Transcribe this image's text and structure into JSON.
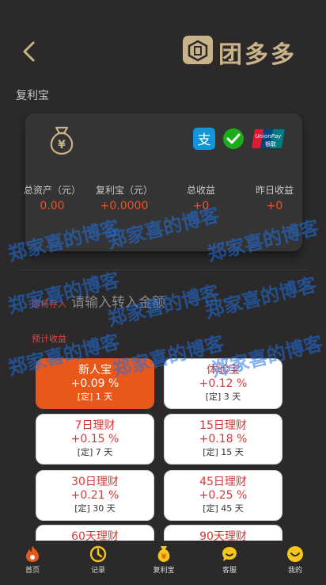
{
  "header": {
    "brand": "团多多"
  },
  "section_title": "复利宝",
  "card": {
    "stats": [
      {
        "label": "总资产（元）",
        "value": "0.00"
      },
      {
        "label": "复利宝（元）",
        "value": "+0.0000"
      },
      {
        "label": "总收益",
        "value": "+0"
      },
      {
        "label": "昨日收益",
        "value": "+0"
      }
    ],
    "unionpay_text": "UnionPay",
    "unionpay_sub": "银联"
  },
  "transfer": {
    "label": "即将存入",
    "placeholder": "请输入转入金额"
  },
  "estimate_label": "预计收益",
  "plans": [
    {
      "name": "新人宝",
      "rate": "+0.09 %",
      "term": "[定] 1 天",
      "active": true
    },
    {
      "name": "体验宝",
      "rate": "+0.12 %",
      "term": "[定] 3 天",
      "active": false
    },
    {
      "name": "7日理财",
      "rate": "+0.15 %",
      "term": "[定] 7 天",
      "active": false
    },
    {
      "name": "15日理财",
      "rate": "+0.18 %",
      "term": "[定] 15 天",
      "active": false
    },
    {
      "name": "30日理财",
      "rate": "+0.21 %",
      "term": "[定] 30 天",
      "active": false
    },
    {
      "name": "45日理财",
      "rate": "+0.25 %",
      "term": "[定] 45 天",
      "active": false
    },
    {
      "name": "60天理财",
      "rate": "",
      "term": "",
      "active": false
    },
    {
      "name": "90天理财",
      "rate": "",
      "term": "",
      "active": false
    }
  ],
  "watermark": "郑家喜的博客",
  "tabs": [
    {
      "label": "首页",
      "icon": "home-flame-icon"
    },
    {
      "label": "记录",
      "icon": "record-icon"
    },
    {
      "label": "复利宝",
      "icon": "money-bag-icon"
    },
    {
      "label": "客服",
      "icon": "chat-icon"
    },
    {
      "label": "我的",
      "icon": "smile-icon"
    }
  ],
  "colors": {
    "accent": "#e8581b",
    "gold": "#c9b48a",
    "background": "#2b2929",
    "value_red": "#e8552c"
  }
}
